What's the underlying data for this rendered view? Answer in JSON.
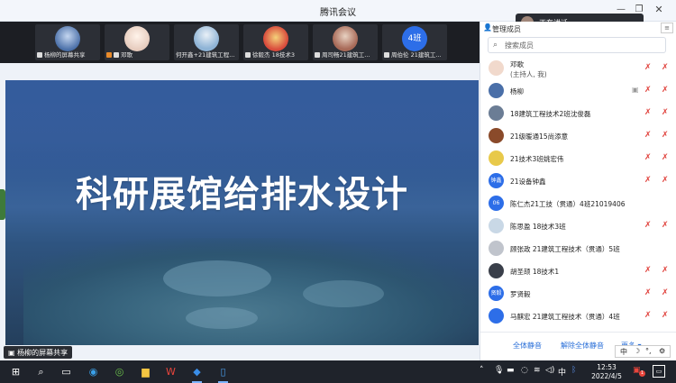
{
  "window": {
    "title": "腾讯会议"
  },
  "speaking": {
    "label": "正在讲话:"
  },
  "video_strip": [
    {
      "caption": "杨柳的屏幕共享",
      "avatar_color": "#4a6fa8"
    },
    {
      "caption": "邓歌",
      "avatar_color": "#f0e2d8"
    },
    {
      "caption": "何开鑫+21建筑工程...",
      "avatar_color": "#8fb4d6"
    },
    {
      "caption": "徐毅杰 18技术3",
      "avatar_color": "#d94b3c"
    },
    {
      "caption": "周司畅21建筑工...",
      "avatar_color": "#a86a58"
    },
    {
      "caption": "周伯伦 21建筑工...",
      "avatar_color": "#2d6ee8",
      "initials": "4班"
    }
  ],
  "shared_screen": {
    "headline": "科研展馆给排水设计",
    "label": "杨柳的屏幕共享"
  },
  "panel": {
    "title": "管理成员",
    "menu_icon": "≡",
    "search_placeholder": "搜索成员",
    "members": [
      {
        "name": "邓歌",
        "sub": "(主持人, 我)",
        "avatar_color": "#f1d9cc",
        "shield": false
      },
      {
        "name": "杨柳",
        "avatar_color": "#4a6fa8",
        "shield": true
      },
      {
        "name": "18建筑工程技术2班沈俊磊",
        "avatar_color": "#6b7d95",
        "shield": false
      },
      {
        "name": "21级暖通15尚添意",
        "avatar_color": "#8a4a2a",
        "shield": false
      },
      {
        "name": "21技术3班姚宏伟",
        "avatar_color": "#e8c94a",
        "shield": false
      },
      {
        "name": "21设备钟鑫",
        "avatar_color": "#2d6ee8",
        "initials": "钟鑫",
        "shield": false
      },
      {
        "name": "陈仁杰21工技（贯通）4班21019406",
        "avatar_color": "#2d6ee8",
        "initials": "06",
        "shield": false
      },
      {
        "name": "陈思盈 18技术3班",
        "avatar_color": "#c9d8e6",
        "shield": false
      },
      {
        "name": "顾张政 21建筑工程技术（贯通）5班",
        "avatar_color": "#c0c4cc",
        "shield": false
      },
      {
        "name": "胡圣颉 18技术1",
        "avatar_color": "#3a3f4a",
        "shield": false
      },
      {
        "name": "罗贤毅",
        "avatar_color": "#2d6ee8",
        "initials": "贤毅",
        "shield": false
      },
      {
        "name": "马麒宏 21建筑工程技术（贯通）4班",
        "avatar_color": "#2d6ee8",
        "shield": false
      }
    ],
    "footer": {
      "mute_all": "全体静音",
      "unmute_all": "解除全体静音",
      "more": "更多 ▾"
    }
  },
  "ime": {
    "lang": "中",
    "moon": "☽",
    "dots": "°,",
    "gear": "⚙"
  },
  "taskbar": {
    "time": "12:53",
    "date": "2022/4/5",
    "ime_lang": "中",
    "notification_count": "1"
  }
}
